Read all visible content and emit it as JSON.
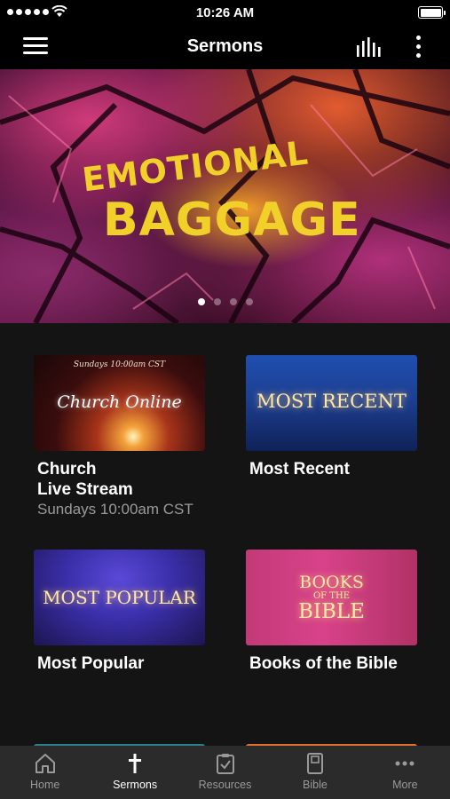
{
  "status_bar": {
    "time": "10:26 AM"
  },
  "nav": {
    "title": "Sermons"
  },
  "hero": {
    "title_top": "EMOTIONAL",
    "title_main": "BAGGAGE",
    "dots": 4,
    "active_dot": 0
  },
  "cards": [
    {
      "title": "Church\nLive Stream",
      "subtitle": "Sundays 10:00am CST",
      "thumb_text": "Church Online",
      "thumb_small": "Sundays 10:00am CST"
    },
    {
      "title": "Most Recent",
      "thumb_text": "MOST RECENT"
    },
    {
      "title": "Most Popular",
      "thumb_text": "MOST POPULAR"
    },
    {
      "title": "Books of the Bible",
      "thumb_line1": "BOOKS",
      "thumb_line2": "OF THE",
      "thumb_line3": "BIBLE"
    }
  ],
  "tabs": [
    {
      "label": "Home",
      "icon": "home-icon",
      "active": false
    },
    {
      "label": "Sermons",
      "icon": "cross-icon",
      "active": true
    },
    {
      "label": "Resources",
      "icon": "clipboard-check-icon",
      "active": false
    },
    {
      "label": "Bible",
      "icon": "book-icon",
      "active": false
    },
    {
      "label": "More",
      "icon": "more-dots-icon",
      "active": false
    }
  ],
  "colors": {
    "accent_yellow": "#f1d02a",
    "background": "#141414",
    "tab_bar": "#2b2b2b"
  }
}
